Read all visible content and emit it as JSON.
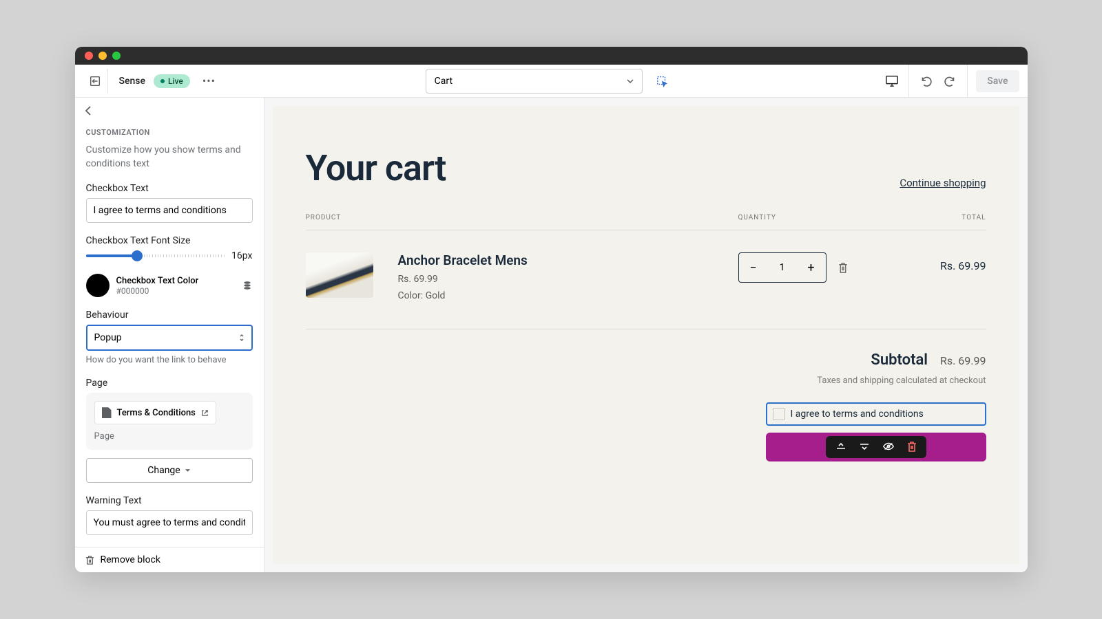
{
  "toolbar": {
    "theme_name": "Sense",
    "live_label": "Live",
    "template_selected": "Cart",
    "save_label": "Save"
  },
  "sidebar": {
    "section_title": "CUSTOMIZATION",
    "section_desc": "Customize how you show terms and conditions text",
    "checkbox_text_label": "Checkbox Text",
    "checkbox_text_value": "I agree to terms and conditions",
    "font_size_label": "Checkbox Text Font Size",
    "font_size_value": "16px",
    "color_label": "Checkbox Text Color",
    "color_hex": "#000000",
    "behaviour_label": "Behaviour",
    "behaviour_value": "Popup",
    "behaviour_help": "How do you want the link to behave",
    "page_label": "Page",
    "page_chip": "Terms & Conditions",
    "page_type": "Page",
    "change_label": "Change",
    "warning_label": "Warning Text",
    "warning_value": "You must agree to terms and conditio",
    "remove_label": "Remove block"
  },
  "preview": {
    "cart_title": "Your cart",
    "continue_link": "Continue shopping",
    "th_product": "PRODUCT",
    "th_qty": "QUANTITY",
    "th_total": "TOTAL",
    "item": {
      "name": "Anchor Bracelet Mens",
      "price": "Rs. 69.99",
      "variant": "Color: Gold",
      "qty": "1",
      "line_total": "Rs. 69.99"
    },
    "subtotal_label": "Subtotal",
    "subtotal_value": "Rs. 69.99",
    "tax_note": "Taxes and shipping calculated at checkout",
    "agree_text": "I agree to terms and conditions"
  }
}
